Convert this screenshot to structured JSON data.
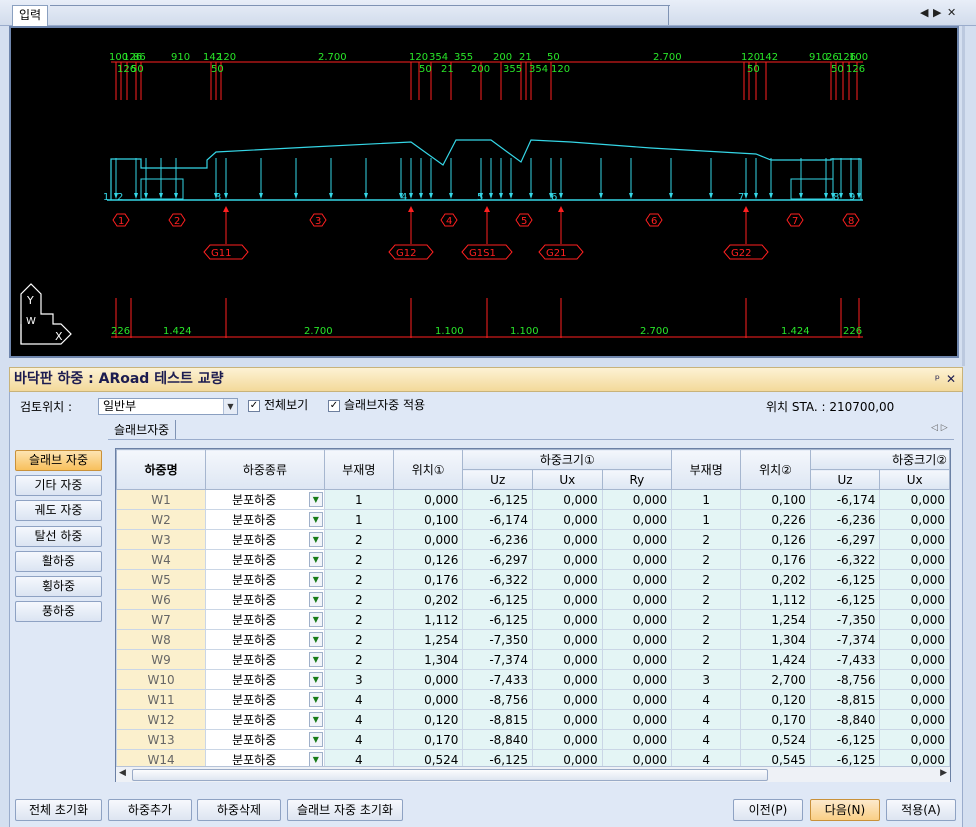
{
  "input_tab": {
    "label": "입력",
    "controls": [
      "◀",
      "▶",
      "✕"
    ]
  },
  "drawing": {
    "top_dims_row1": [
      "100",
      "126",
      "86",
      "910",
      "142",
      "120",
      "2.700",
      "120",
      "354",
      "355",
      "200",
      "21",
      "50",
      "2.700",
      "120",
      "142",
      "910",
      "26",
      "126",
      "100"
    ],
    "top_dims_row2": [
      "126",
      "50",
      "50",
      "50",
      "21",
      "200",
      "355",
      "354",
      "120",
      "50",
      "50",
      "126"
    ],
    "bottom_dims": [
      "226",
      "1.424",
      "2.700",
      "1.100",
      "1.100",
      "2.700",
      "1.424",
      "226"
    ],
    "node_labels": [
      "1",
      "2",
      "3",
      "4",
      "5",
      "6",
      "7",
      "8",
      "9"
    ],
    "member_labels": [
      "1",
      "2",
      "3",
      "4",
      "5",
      "6",
      "7",
      "8"
    ],
    "girders": [
      "G11",
      "G12",
      "G1S1",
      "G21",
      "G22"
    ],
    "axis": {
      "y": "Y",
      "x": "X",
      "w": "W"
    }
  },
  "panel": {
    "title": "바닥판 하중 : ARoad 테스트 교량",
    "pin": "ᵖ",
    "close": "✕",
    "check_position_label": "검토위치 :",
    "check_position_value": "일반부",
    "show_all_label": "전체보기",
    "slab_apply_label": "슬래브자중 적용",
    "station": "위치  STA.  : 210700,00",
    "sub_tab": "슬래브자중"
  },
  "side_buttons": [
    "슬래브 자중",
    "기타 자중",
    "궤도 자중",
    "탈선 하중",
    "활하중",
    "횡하중",
    "풍하중"
  ],
  "grid": {
    "headers": {
      "name": "하중명",
      "kind": "하중종류",
      "member1": "부재명",
      "pos1": "위치①",
      "load1": "하중크기①",
      "member2": "부재명",
      "pos2": "위치②",
      "load2": "하중크기②",
      "uz": "Uz",
      "ux": "Ux",
      "ry": "Ry"
    },
    "rows": [
      [
        "W1",
        "분포하중",
        "1",
        "0,000",
        "-6,125",
        "0,000",
        "0,000",
        "1",
        "0,100",
        "-6,174",
        "0,000"
      ],
      [
        "W2",
        "분포하중",
        "1",
        "0,100",
        "-6,174",
        "0,000",
        "0,000",
        "1",
        "0,226",
        "-6,236",
        "0,000"
      ],
      [
        "W3",
        "분포하중",
        "2",
        "0,000",
        "-6,236",
        "0,000",
        "0,000",
        "2",
        "0,126",
        "-6,297",
        "0,000"
      ],
      [
        "W4",
        "분포하중",
        "2",
        "0,126",
        "-6,297",
        "0,000",
        "0,000",
        "2",
        "0,176",
        "-6,322",
        "0,000"
      ],
      [
        "W5",
        "분포하중",
        "2",
        "0,176",
        "-6,322",
        "0,000",
        "0,000",
        "2",
        "0,202",
        "-6,125",
        "0,000"
      ],
      [
        "W6",
        "분포하중",
        "2",
        "0,202",
        "-6,125",
        "0,000",
        "0,000",
        "2",
        "1,112",
        "-6,125",
        "0,000"
      ],
      [
        "W7",
        "분포하중",
        "2",
        "1,112",
        "-6,125",
        "0,000",
        "0,000",
        "2",
        "1,254",
        "-7,350",
        "0,000"
      ],
      [
        "W8",
        "분포하중",
        "2",
        "1,254",
        "-7,350",
        "0,000",
        "0,000",
        "2",
        "1,304",
        "-7,374",
        "0,000"
      ],
      [
        "W9",
        "분포하중",
        "2",
        "1,304",
        "-7,374",
        "0,000",
        "0,000",
        "2",
        "1,424",
        "-7,433",
        "0,000"
      ],
      [
        "W10",
        "분포하중",
        "3",
        "0,000",
        "-7,433",
        "0,000",
        "0,000",
        "3",
        "2,700",
        "-8,756",
        "0,000"
      ],
      [
        "W11",
        "분포하중",
        "4",
        "0,000",
        "-8,756",
        "0,000",
        "0,000",
        "4",
        "0,120",
        "-8,815",
        "0,000"
      ],
      [
        "W12",
        "분포하중",
        "4",
        "0,120",
        "-8,815",
        "0,000",
        "0,000",
        "4",
        "0,170",
        "-8,840",
        "0,000"
      ],
      [
        "W13",
        "분포하중",
        "4",
        "0,170",
        "-8,840",
        "0,000",
        "0,000",
        "4",
        "0,524",
        "-6,125",
        "0,000"
      ],
      [
        "W14",
        "분포하중",
        "4",
        "0,524",
        "-6,125",
        "0,000",
        "0,000",
        "4",
        "0,545",
        "-6,125",
        "0,000"
      ]
    ]
  },
  "bottom_buttons": {
    "reset_all": "전체 초기화",
    "add_load": "하중추가",
    "delete_load": "하중삭제",
    "reset_slab": "슬래브 자중 초기화",
    "prev": "이전(P)",
    "next": "다음(N)",
    "apply": "적용(A)"
  },
  "colors": {
    "dim": "#ff2020",
    "dim_text": "#29e629",
    "structure": "#35d6e6",
    "label_red": "#ff2020"
  }
}
